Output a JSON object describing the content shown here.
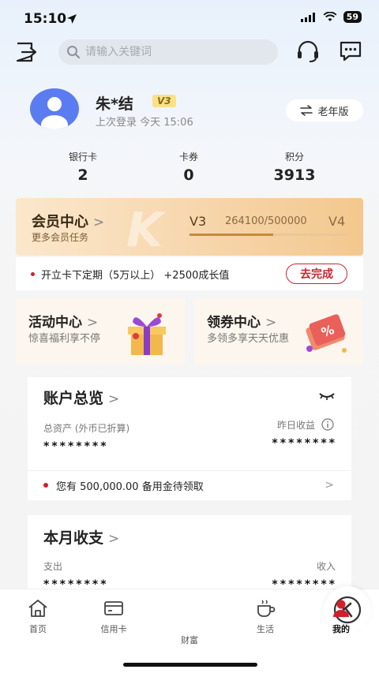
{
  "status_bar": {
    "time": "15:10",
    "battery": "59"
  },
  "search": {
    "placeholder": "请输入关键词"
  },
  "profile": {
    "username": "朱*结",
    "level": "V3",
    "last_login": "上次登录 今天 15:06",
    "elder_mode_label": "老年版"
  },
  "stats": [
    {
      "label": "银行卡",
      "value": "2"
    },
    {
      "label": "卡券",
      "value": "0"
    },
    {
      "label": "积分",
      "value": "3913"
    }
  ],
  "member": {
    "title": "会员中心",
    "subtitle": "更多会员任务",
    "current_level": "V3",
    "progress_text": "264100/500000",
    "next_level": "V4",
    "progress_fraction": 0.5282
  },
  "task": {
    "text": "开立卡下定期（5万以上） +2500成长值",
    "button_label": "去完成"
  },
  "promos": [
    {
      "title": "活动中心",
      "subtitle": "惊喜福利享不停"
    },
    {
      "title": "领券中心",
      "subtitle": "多领多享天天优惠"
    }
  ],
  "account": {
    "title": "账户总览",
    "assets_label": "总资产 (外币已折算)",
    "assets_value": "********",
    "yesterday_label": "昨日收益",
    "yesterday_value": "********",
    "notice": "您有 500,000.00 备用金待领取"
  },
  "monthly": {
    "title": "本月收支",
    "expense_label": "支出",
    "expense_value": "********",
    "income_label": "收入",
    "income_value": "********"
  },
  "nav": [
    {
      "label": "首页",
      "icon": "home-icon"
    },
    {
      "label": "信用卡",
      "icon": "credit-card-icon"
    },
    {
      "label": "财富",
      "icon": "wealth-icon"
    },
    {
      "label": "生活",
      "icon": "coffee-icon"
    },
    {
      "label": "我的",
      "icon": "user-icon",
      "active": true
    }
  ],
  "colors": {
    "accent": "#d0202c",
    "gold": "#c48a3c",
    "avatar": "#5b7cf0"
  }
}
